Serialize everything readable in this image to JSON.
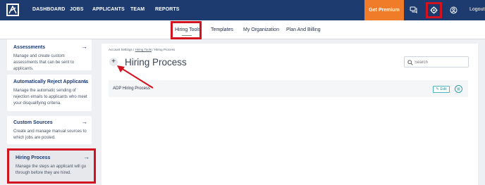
{
  "nav": {
    "links": [
      "DASHBOARD",
      "JOBS",
      "APPLICANTS",
      "TEAM",
      "REPORTS"
    ],
    "premium": "Get Premium",
    "logout": "Logout"
  },
  "subnav": {
    "tabs": [
      "Hiring Tools",
      "Templates",
      "My Organization",
      "Plan And Billing"
    ],
    "active": "Hiring Tools"
  },
  "sidebar": {
    "items": [
      {
        "title": "Assessments",
        "desc": "Manage and create custom assessments that can be sent to applicants."
      },
      {
        "title": "Automatically Reject Applicants",
        "desc": "Manage the automatic sending of rejection emails to applicants who meet your disqualifying criteria."
      },
      {
        "title": "Custom Sources",
        "desc": "Create and manage manual sources to which jobs are posted."
      },
      {
        "title": "Hiring Process",
        "desc": "Manage the steps an applicant will go through before they are hired."
      }
    ]
  },
  "main": {
    "breadcrumb": {
      "root": "Account Settings",
      "sep": "/",
      "middle": "Hiring Tools",
      "current": "Hiring Process"
    },
    "add_symbol": "+",
    "title": "Hiring Process",
    "search_placeholder": "Search",
    "rows": [
      {
        "label": "ADP Hiring Process",
        "edit": "Edit"
      }
    ]
  },
  "colors": {
    "nav_bg": "#1d3b6e",
    "premium": "#f07c2a",
    "highlight": "#d3121f",
    "accent": "#2d9aa3"
  },
  "icons": [
    "logo-icon",
    "chat-icon",
    "gear-icon",
    "user-icon",
    "search-icon",
    "arrow-right-icon",
    "pencil-icon",
    "delete-icon"
  ]
}
